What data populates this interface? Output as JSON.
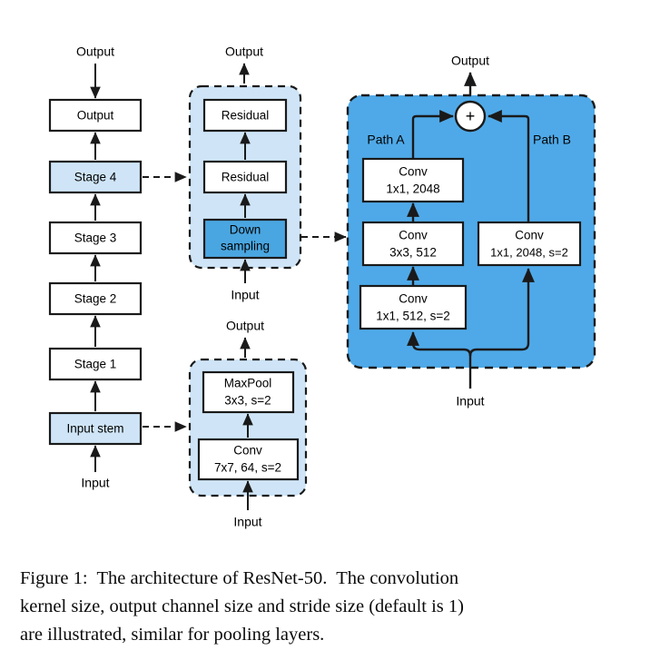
{
  "figure": {
    "caption_lines": [
      "Figure 1:  The architecture of ResNet-50.  The convolution",
      "kernel size, output channel size and stride size (default is 1)",
      "are illustrated, similar for pooling layers."
    ]
  },
  "colors": {
    "light_blue": "#cfe5f7",
    "mid_blue": "#4aa6e0",
    "panel_blue": "#4fa9e8",
    "box_white": "#ffffff",
    "stroke": "#1a1a1a",
    "dashed_stroke": "#1a1a1a"
  },
  "overview_column": {
    "top_label": "Output",
    "bottom_label": "Input",
    "boxes": [
      {
        "label": "Output",
        "fill": "white"
      },
      {
        "label": "Stage 4",
        "fill": "light_blue"
      },
      {
        "label": "Stage 3",
        "fill": "white"
      },
      {
        "label": "Stage 2",
        "fill": "white"
      },
      {
        "label": "Stage 1",
        "fill": "white"
      },
      {
        "label": "Input stem",
        "fill": "light_blue"
      }
    ]
  },
  "stage4_detail": {
    "top_label": "Output",
    "bottom_label": "Input",
    "boxes": [
      {
        "line1": "Residual",
        "line2": "",
        "fill": "white"
      },
      {
        "line1": "Residual",
        "line2": "",
        "fill": "white"
      },
      {
        "line1": "Down",
        "line2": "sampling",
        "fill": "mid_blue"
      }
    ]
  },
  "input_stem_detail": {
    "top_label": "Output",
    "bottom_label": "Input",
    "boxes": [
      {
        "line1": "MaxPool",
        "line2": "3x3, s=2",
        "fill": "white"
      },
      {
        "line1": "Conv",
        "line2": "7x7, 64, s=2",
        "fill": "white"
      }
    ]
  },
  "downsampling_detail": {
    "top_label": "Output",
    "bottom_label": "Input",
    "junction_symbol": "+",
    "path_a_label": "Path A",
    "path_b_label": "Path B",
    "path_a_boxes": [
      {
        "line1": "Conv",
        "line2": "1x1, 2048"
      },
      {
        "line1": "Conv",
        "line2": "3x3, 512"
      },
      {
        "line1": "Conv",
        "line2": "1x1, 512, s=2"
      }
    ],
    "path_b_boxes": [
      {
        "line1": "Conv",
        "line2": "1x1, 2048, s=2"
      }
    ]
  }
}
